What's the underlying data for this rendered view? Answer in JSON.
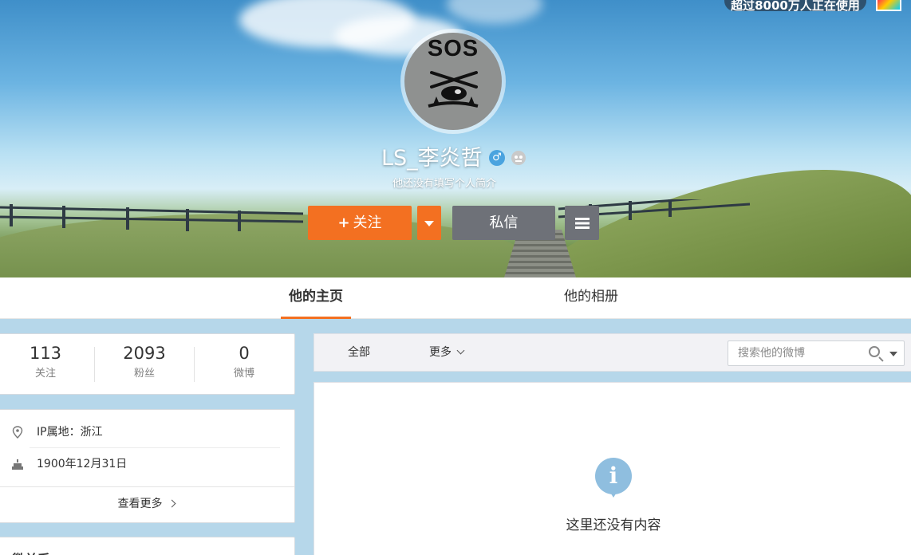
{
  "topbar": {
    "promo_text": "超过8000万人正在使用"
  },
  "profile": {
    "username": "LS_李炎哲",
    "gender_symbol": "♂",
    "bio": "他还没有填写个人简介",
    "avatar_text": "SOS"
  },
  "actions": {
    "follow_plus": "+",
    "follow_label": "关注",
    "message_label": "私信"
  },
  "tabs": [
    {
      "label": "他的主页",
      "active": true
    },
    {
      "label": "他的相册",
      "active": false
    }
  ],
  "stats": [
    {
      "value": "113",
      "label": "关注"
    },
    {
      "value": "2093",
      "label": "粉丝"
    },
    {
      "value": "0",
      "label": "微博"
    }
  ],
  "info": {
    "ip_location": "IP属地：浙江",
    "birthday": "1900年12月31日",
    "more_label": "查看更多"
  },
  "sidebar_card_title": "微关系",
  "feed": {
    "filters": [
      "全部",
      "更多"
    ],
    "search_placeholder": "搜索他的微博",
    "empty_icon": "i",
    "empty_message": "这里还没有内容"
  },
  "colors": {
    "accent": "#f37021",
    "secondary_button": "#6e7178",
    "page_background": "#b6d7ea",
    "info_icon": "#8fbedf"
  }
}
